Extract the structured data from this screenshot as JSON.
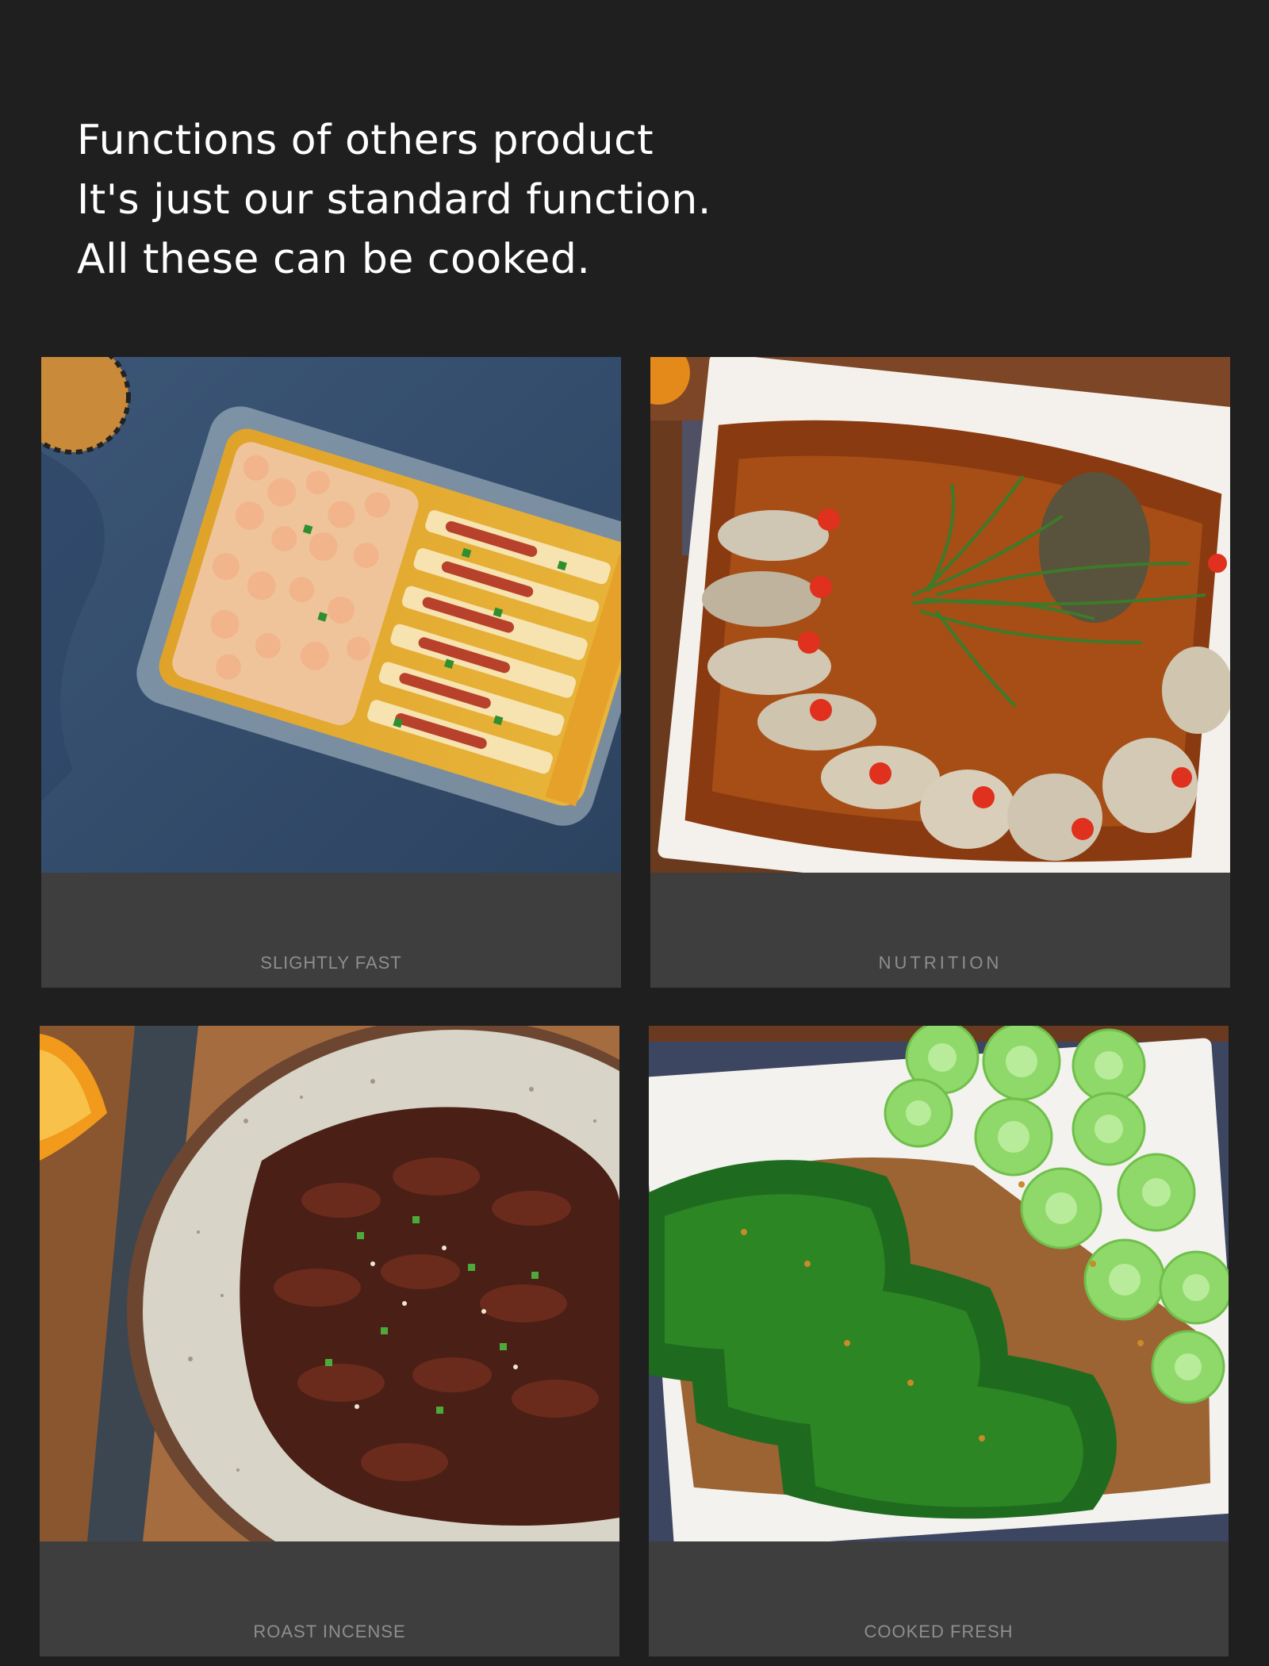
{
  "heading": {
    "line1": "Functions of others product",
    "line2": "It's just our standard function.",
    "line3": "All these can be cooked."
  },
  "cards": [
    {
      "caption": "SLIGHTLY FAST",
      "photo": "steamed-shrimp-tofu-photo"
    },
    {
      "caption": "NUTRITION",
      "photo": "steamed-fish-photo"
    },
    {
      "caption": "ROAST INCENSE",
      "photo": "roast-beef-bowl-photo"
    },
    {
      "caption": "COOKED FRESH",
      "photo": "bok-choy-photo"
    }
  ]
}
